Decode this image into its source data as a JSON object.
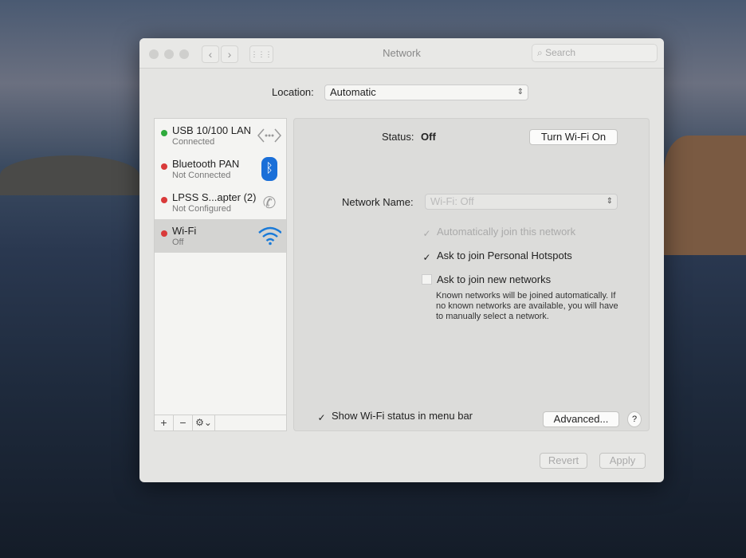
{
  "window": {
    "title": "Network",
    "search_placeholder": "Search",
    "back": "‹",
    "forward": "›",
    "grid": "⋮⋮⋮"
  },
  "location": {
    "label": "Location:",
    "value": "Automatic"
  },
  "services": [
    {
      "name": "USB 10/100 LAN",
      "status": "Connected",
      "color": "#2eaa3c",
      "icon": "ethernet-icon"
    },
    {
      "name": "Bluetooth PAN",
      "status": "Not Connected",
      "color": "#d93a3a",
      "icon": "bluetooth-icon"
    },
    {
      "name": "LPSS S...apter (2)",
      "status": "Not Configured",
      "color": "#d93a3a",
      "icon": "phone-icon"
    },
    {
      "name": "Wi-Fi",
      "status": "Off",
      "color": "#d93a3a",
      "icon": "wifi-icon"
    }
  ],
  "sidebar_toolbar": {
    "add": "+",
    "remove": "−",
    "gear": "⚙⌄"
  },
  "detail": {
    "status_label": "Status:",
    "status_value": "Off",
    "turn_on": "Turn Wi-Fi On",
    "network_name_label": "Network Name:",
    "network_name_value": "Wi-Fi: Off",
    "auto_join": "Automatically join this network",
    "ask_hotspots": "Ask to join Personal Hotspots",
    "ask_new": "Ask to join new networks",
    "help": "Known networks will be joined automatically. If no known networks are available, you will have to manually select a network.",
    "show_status": "Show Wi-Fi status in menu bar",
    "advanced": "Advanced...",
    "help_btn": "?"
  },
  "footer": {
    "revert": "Revert",
    "apply": "Apply"
  },
  "checks": {
    "mark": "✓"
  }
}
